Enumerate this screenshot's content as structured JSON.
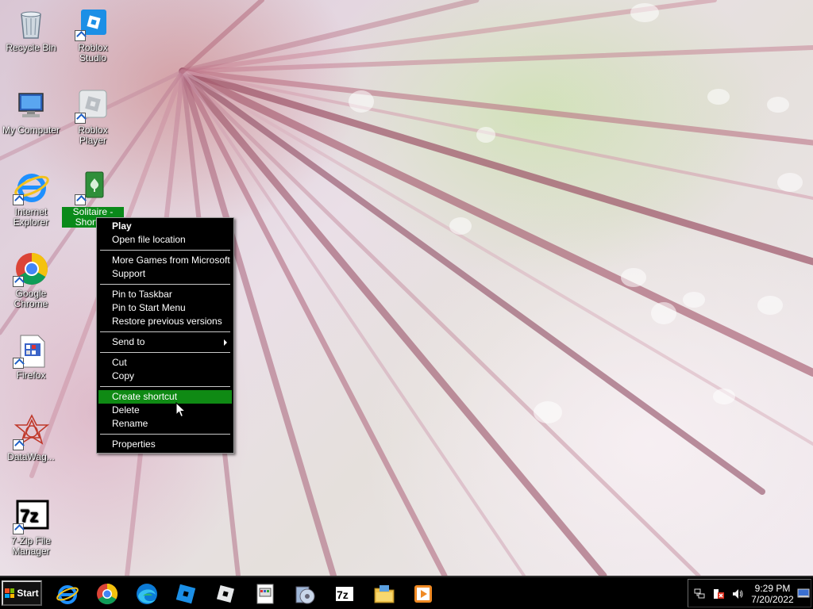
{
  "desktop": {
    "icons": [
      {
        "label": "Recycle Bin",
        "icon": "recycle-bin-icon"
      },
      {
        "label": "Roblox Studio",
        "icon": "roblox-studio-icon"
      },
      {
        "label": "My Computer",
        "icon": "my-computer-icon"
      },
      {
        "label": "Roblox Player",
        "icon": "roblox-player-icon"
      },
      {
        "label": "Internet Explorer",
        "icon": "internet-explorer-icon"
      },
      {
        "label": "Solitaire - Shortcut",
        "icon": "solitaire-icon",
        "selected": true
      },
      {
        "label": "Google Chrome",
        "icon": "chrome-icon"
      },
      {
        "label": "Firefox",
        "icon": "firefox-icon"
      },
      {
        "label": "DataWag...",
        "icon": "datawag-icon"
      },
      {
        "label": "7-Zip File Manager",
        "icon": "7zip-icon"
      }
    ]
  },
  "context_menu": {
    "items": [
      {
        "label": "Play",
        "bold": true
      },
      {
        "label": "Open file location"
      },
      {
        "separator": true
      },
      {
        "label": "More Games from Microsoft"
      },
      {
        "label": "Support"
      },
      {
        "separator": true
      },
      {
        "label": "Pin to Taskbar"
      },
      {
        "label": "Pin to Start Menu"
      },
      {
        "label": "Restore previous versions"
      },
      {
        "separator": true
      },
      {
        "label": "Send to",
        "submenu": true
      },
      {
        "separator": true
      },
      {
        "label": "Cut"
      },
      {
        "label": "Copy"
      },
      {
        "separator": true
      },
      {
        "label": "Create shortcut",
        "highlighted": true
      },
      {
        "label": "Delete"
      },
      {
        "label": "Rename"
      },
      {
        "separator": true
      },
      {
        "label": "Properties"
      }
    ]
  },
  "taskbar": {
    "start_label": "Start",
    "pinned": [
      "internet-explorer-icon",
      "chrome-icon",
      "edge-icon",
      "roblox-studio-icon",
      "roblox-player-icon",
      "control-panel-icon",
      "media-center-icon",
      "7zip-icon",
      "file-explorer-icon",
      "media-player-icon"
    ],
    "tray": {
      "icons": [
        "network-icon",
        "action-center-icon",
        "volume-icon"
      ],
      "time": "9:29 PM",
      "date": "7/20/2022"
    }
  },
  "colors": {
    "highlight": "#0f8a14",
    "menu_bg": "#000000",
    "taskbar_bg": "#000000",
    "selection": "#0a8a1a"
  }
}
